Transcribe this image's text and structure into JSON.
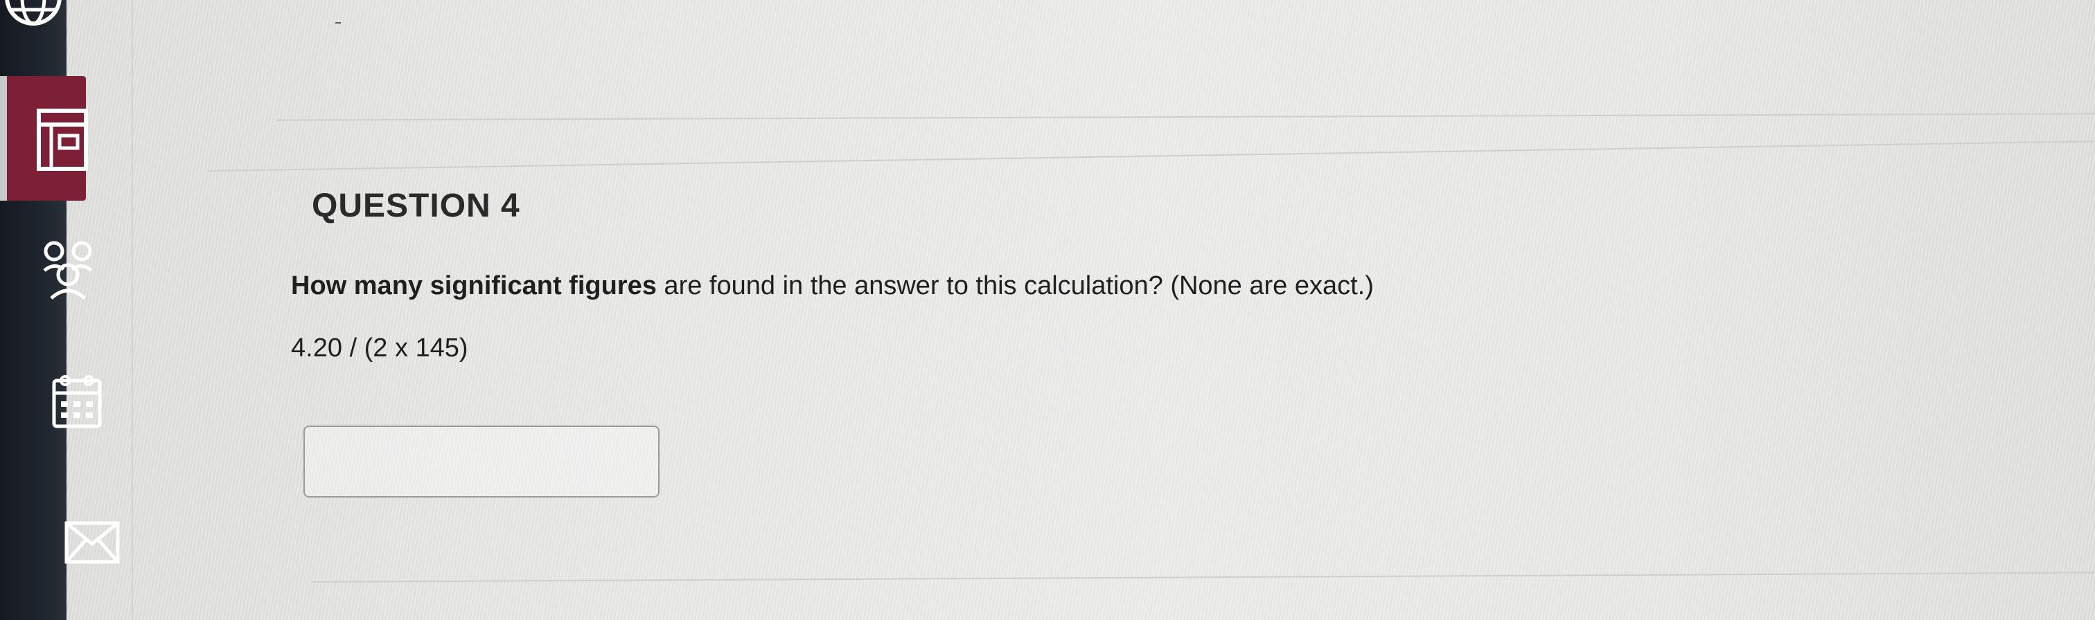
{
  "nav": {
    "items": [
      {
        "id": "globe",
        "icon": "globe-icon"
      },
      {
        "id": "institution",
        "icon": "institution-page-icon",
        "active": true
      },
      {
        "id": "community",
        "icon": "community-icon"
      },
      {
        "id": "calendar",
        "icon": "calendar-icon"
      },
      {
        "id": "messages",
        "icon": "mail-icon"
      }
    ],
    "active_color": "#7d1f37"
  },
  "question": {
    "title": "QUESTION 4",
    "text_bold": "How many significant figures",
    "text_rest": " are found in the answer to this calculation?  (None are exact.)",
    "expression": "4.20 / (2 x 145)",
    "answer_value": "",
    "answer_placeholder": ""
  }
}
